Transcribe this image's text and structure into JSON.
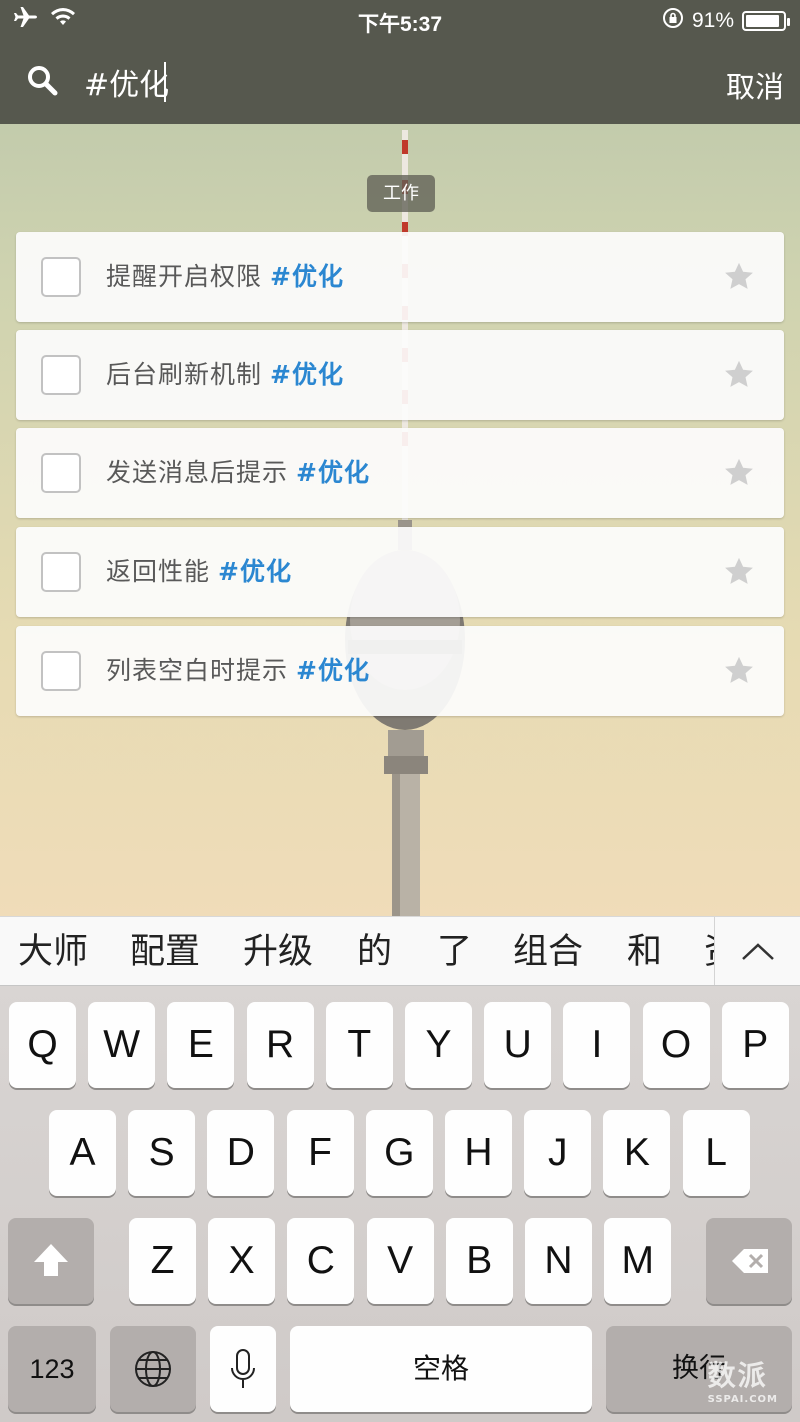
{
  "status_bar": {
    "time": "下午5:37",
    "battery": "91%",
    "battery_level": 0.91
  },
  "search": {
    "query": "#优化",
    "cancel_label": "取消"
  },
  "list_name": "工作",
  "tasks": [
    {
      "title": "提醒开启权限",
      "tag": "#优化"
    },
    {
      "title": "后台刷新机制",
      "tag": "#优化"
    },
    {
      "title": "发送消息后提示",
      "tag": "#优化"
    },
    {
      "title": "返回性能",
      "tag": "#优化"
    },
    {
      "title": "列表空白时提示",
      "tag": "#优化"
    }
  ],
  "candidates": [
    "大师",
    "配置",
    "升级",
    "的",
    "了",
    "组合",
    "和",
    "资"
  ],
  "keyboard": {
    "row1": [
      "Q",
      "W",
      "E",
      "R",
      "T",
      "Y",
      "U",
      "I",
      "O",
      "P"
    ],
    "row2": [
      "A",
      "S",
      "D",
      "F",
      "G",
      "H",
      "J",
      "K",
      "L"
    ],
    "row3": [
      "Z",
      "X",
      "C",
      "V",
      "B",
      "N",
      "M"
    ],
    "numbers_label": "123",
    "space_label": "空格",
    "return_label": "换行"
  },
  "watermark": {
    "text": "数派",
    "sub": "SSPAI.COM"
  },
  "colors": {
    "tag": "#2b87d1",
    "topbar": "#56584e",
    "star": "#cfcfcf"
  }
}
